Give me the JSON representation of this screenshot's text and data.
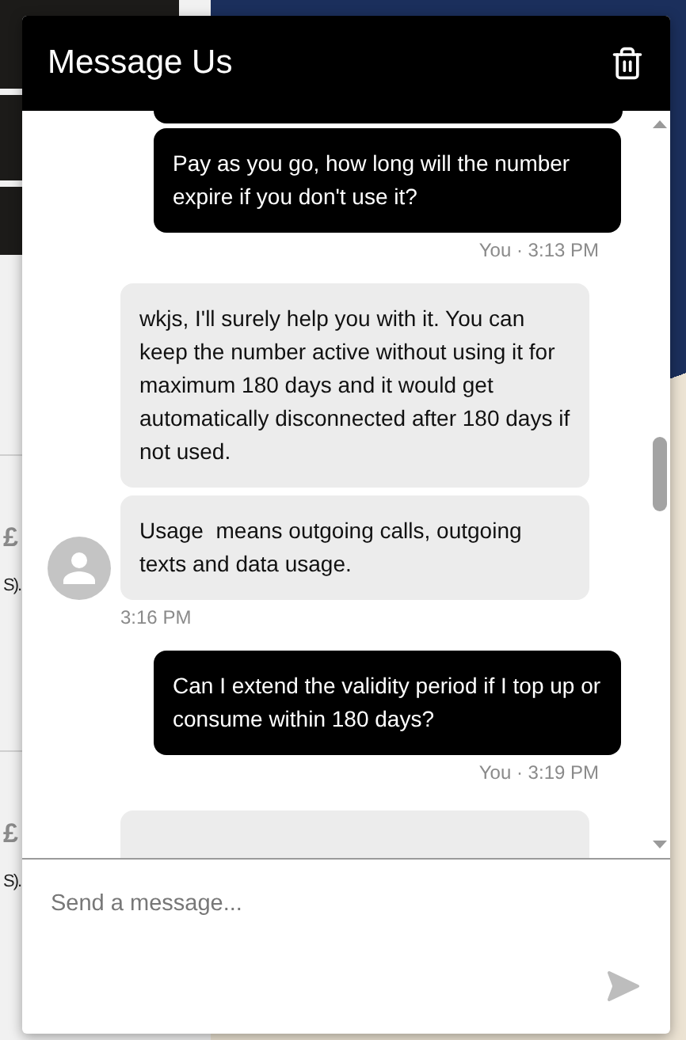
{
  "background": {
    "fragments": [
      {
        "kind": "price",
        "text": "£"
      },
      {
        "kind": "note",
        "text": "S)."
      },
      {
        "kind": "price",
        "text": "£"
      },
      {
        "kind": "note",
        "text": "S)."
      }
    ]
  },
  "chat": {
    "title": "Message Us",
    "clipped_above": {
      "kind": "sent"
    },
    "messages": [
      {
        "kind": "sent",
        "texts": [
          "Pay as you go, how long will the number expire if you don't use it?"
        ],
        "meta": "You · 3:13 PM"
      },
      {
        "kind": "received",
        "texts": [
          "wkjs, I'll surely help you with it. You can keep the number active without using it for maximum 180 days and it would get automatically disconnected after 180 days if not used.",
          "Usage  means outgoing calls, outgoing texts and data usage."
        ],
        "meta": "3:16 PM"
      },
      {
        "kind": "sent",
        "texts": [
          "Can I extend the validity period if I top up or consume within 180 days?"
        ],
        "meta": "You · 3:19 PM"
      }
    ],
    "clipped_below": {
      "kind": "received"
    },
    "composer": {
      "placeholder": "Send a message..."
    }
  }
}
